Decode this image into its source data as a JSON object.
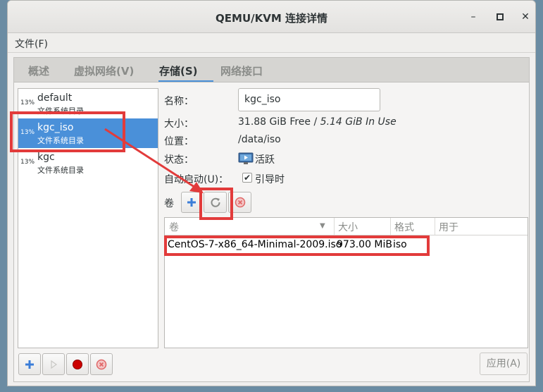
{
  "window": {
    "title": "QEMU/KVM 连接详情"
  },
  "menubar": {
    "file": "文件(F)"
  },
  "tabs": [
    {
      "label": "概述"
    },
    {
      "label": "虚拟网络(V)"
    },
    {
      "label": "存储(S)",
      "active": true
    },
    {
      "label": "网络接口"
    }
  ],
  "pools": [
    {
      "percent": "13%",
      "name": "default",
      "type": "文件系统目录"
    },
    {
      "percent": "13%",
      "name": "kgc_iso",
      "type": "文件系统目录",
      "selected": true
    },
    {
      "percent": "13%",
      "name": "kgc",
      "type": "文件系统目录"
    }
  ],
  "details": {
    "name_label": "名称：",
    "name_value": "kgc_iso",
    "size_label": "大小：",
    "size_free": "31.88 GiB Free / ",
    "size_inuse": "5.14 GiB In Use",
    "location_label": "位置：",
    "location_value": "/data/iso",
    "state_label": "状态：",
    "state_value": "活跃",
    "autostart_label": "自动启动(U)：",
    "autostart_value": "引导时",
    "autostart_checked": true,
    "volumes_label": "卷"
  },
  "volume_table": {
    "columns": [
      "卷",
      "大小",
      "格式",
      "用于"
    ],
    "rows": [
      {
        "name": "CentOS-7-x86_64-Minimal-2009.iso",
        "size": "973.00 MiB",
        "format": "iso",
        "used_by": ""
      }
    ]
  },
  "buttons": {
    "apply": "应用(A)"
  },
  "colors": {
    "selection": "#4a90d9",
    "annotation": "#e23b3b",
    "add": "#3b7dd8",
    "record": "#cc0000",
    "delete": "#e06666"
  }
}
